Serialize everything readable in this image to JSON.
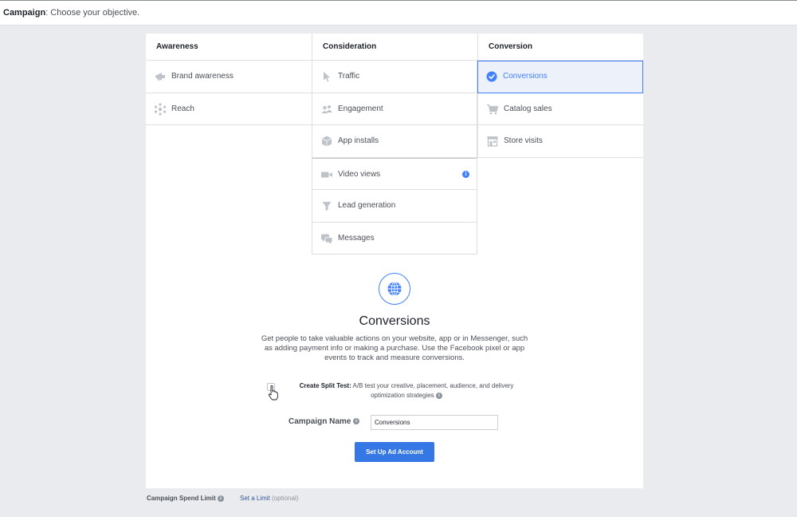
{
  "header": {
    "crumb_strong": "Campaign",
    "crumb_rest": ": Choose your objective."
  },
  "columns": [
    {
      "title": "Awareness",
      "items": [
        {
          "label": "Brand awareness",
          "icon": "megaphone-icon"
        },
        {
          "label": "Reach",
          "icon": "reach-icon"
        }
      ]
    },
    {
      "title": "Consideration",
      "items": [
        {
          "label": "Traffic",
          "icon": "cursor-icon"
        },
        {
          "label": "Engagement",
          "icon": "people-icon"
        },
        {
          "label": "App installs",
          "icon": "box-icon"
        },
        {
          "label": "Video views",
          "icon": "video-camera-icon"
        },
        {
          "label": "Lead generation",
          "icon": "funnel-icon"
        },
        {
          "label": "Messages",
          "icon": "chat-bubbles-icon"
        }
      ]
    },
    {
      "title": "Conversion",
      "items": [
        {
          "label": "Conversions",
          "icon": "checkmark-circle-icon",
          "selected": true
        },
        {
          "label": "Catalog sales",
          "icon": "shopping-cart-icon"
        },
        {
          "label": "Store visits",
          "icon": "store-icon"
        }
      ]
    }
  ],
  "objective": {
    "title": "Conversions",
    "description": "Get people to take valuable actions on your website, app or in Messenger, such as adding payment info or making a purchase. Use the Facebook pixel or app events to track and measure conversions.",
    "icon": "globe-icon"
  },
  "split_test": {
    "label": "Create Split Test:",
    "description": "A/B test your creative, placement, audience, and delivery optimization strategies",
    "checked": false
  },
  "campaign_name": {
    "label": "Campaign Name",
    "value": "Conversions"
  },
  "setup_button": "Set Up Ad Account",
  "footer": {
    "spend_label": "Campaign Spend Limit",
    "set_limit": "Set a Limit",
    "optional": "(optional)"
  },
  "colors": {
    "accent": "#4080ff",
    "button": "#3578e5",
    "selected_bg": "#edf2fa",
    "icon_gray": "#bec3c9"
  }
}
